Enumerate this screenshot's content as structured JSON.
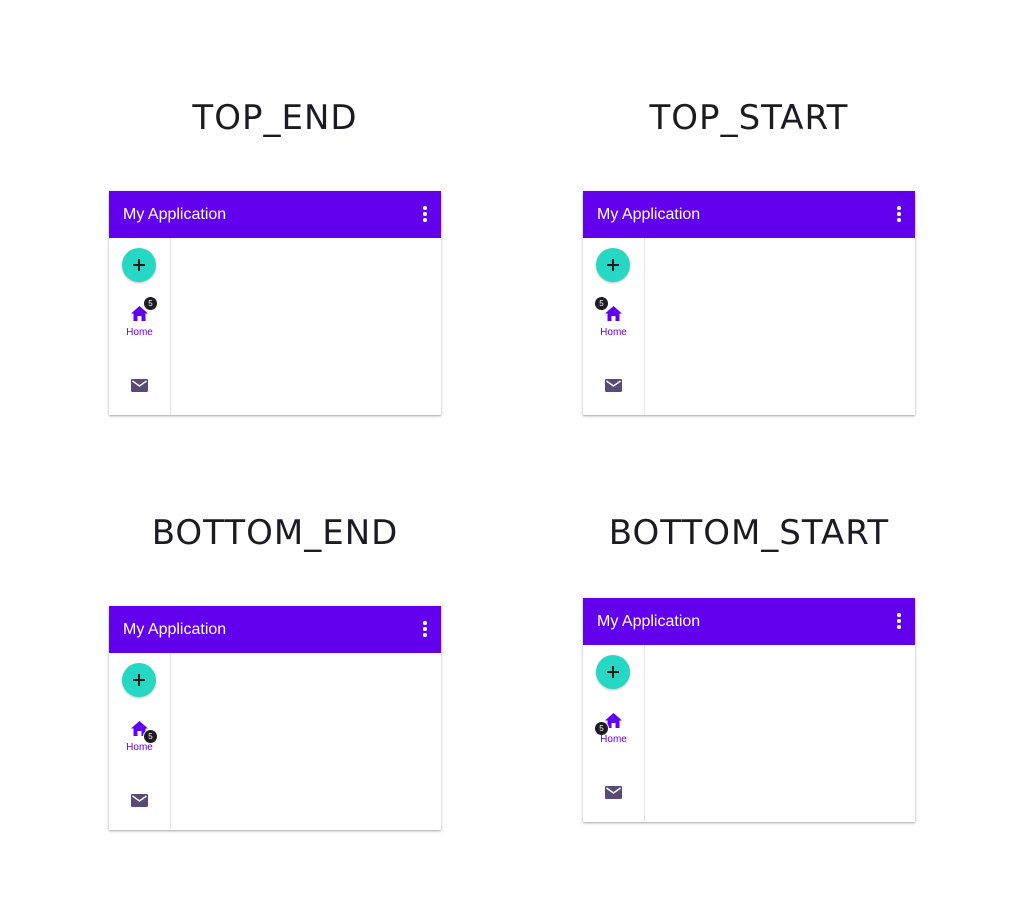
{
  "variants": [
    {
      "title": "TOP_END",
      "app_title": "My Application",
      "nav_label": "Home",
      "badge_count": "5",
      "badge_position": "top-end"
    },
    {
      "title": "TOP_START",
      "app_title": "My Application",
      "nav_label": "Home",
      "badge_count": "5",
      "badge_position": "top-start"
    },
    {
      "title": "BOTTOM_END",
      "app_title": "My Application",
      "nav_label": "Home",
      "badge_count": "5",
      "badge_position": "bottom-end"
    },
    {
      "title": "BOTTOM_START",
      "app_title": "My Application",
      "nav_label": "Home",
      "badge_count": "5",
      "badge_position": "bottom-start"
    }
  ],
  "icons": {
    "fab": "plus-icon",
    "overflow": "more-vert-icon",
    "nav_home": "home-icon",
    "nav_mail": "mail-icon"
  },
  "colors": {
    "app_bar": "#6200ee",
    "fab": "#26d7c4",
    "badge": "#1e1c22",
    "nav_selected": "#6200ee",
    "nav_unselected": "#5a4a78"
  }
}
